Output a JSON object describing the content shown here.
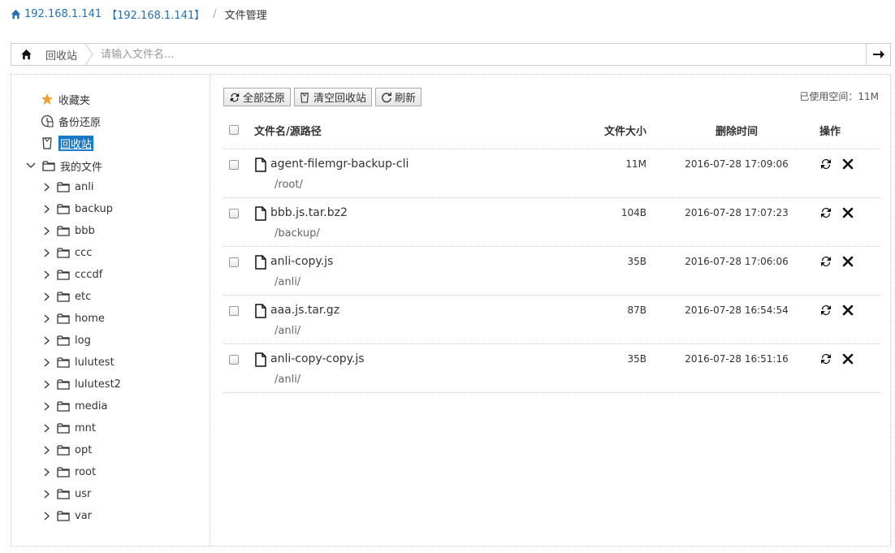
{
  "breadcrumb": {
    "host": "192.168.1.141",
    "host_bracket": "【192.168.1.141】",
    "separator": "/",
    "current": "文件管理"
  },
  "pathbar": {
    "home_icon": "home-icon",
    "crumb": "回收站",
    "search_placeholder": "请输入文件名...",
    "go_icon": "arrow-right-icon"
  },
  "sidebar": {
    "favorites": "收藏夹",
    "backup_restore": "备份还原",
    "recycle_bin": "回收站",
    "my_files": "我的文件",
    "folders": [
      "anli",
      "backup",
      "bbb",
      "ccc",
      "cccdf",
      "etc",
      "home",
      "log",
      "lulutest",
      "lulutest2",
      "media",
      "mnt",
      "opt",
      "root",
      "usr",
      "var"
    ]
  },
  "toolbar": {
    "restore_all": "全部还原",
    "empty_bin": "清空回收站",
    "refresh": "刷新",
    "usage": "已使用空间：11M"
  },
  "table": {
    "headers": {
      "name": "文件名/源路径",
      "size": "文件大小",
      "time": "删除时间",
      "ops": "操作"
    },
    "rows": [
      {
        "name": "agent-filemgr-backup-cli",
        "path": "/root/",
        "size": "11M",
        "time": "2016-07-28 17:09:06"
      },
      {
        "name": "bbb.js.tar.bz2",
        "path": "/backup/",
        "size": "104B",
        "time": "2016-07-28 17:07:23"
      },
      {
        "name": "anli-copy.js",
        "path": "/anli/",
        "size": "35B",
        "time": "2016-07-28 17:06:06"
      },
      {
        "name": "aaa.js.tar.gz",
        "path": "/anli/",
        "size": "87B",
        "time": "2016-07-28 16:54:54"
      },
      {
        "name": "anli-copy-copy.js",
        "path": "/anli/",
        "size": "35B",
        "time": "2016-07-28 16:51:16"
      }
    ]
  },
  "colors": {
    "accent": "#1a77c4",
    "link": "#2a6fb1",
    "star": "#f0a030"
  }
}
